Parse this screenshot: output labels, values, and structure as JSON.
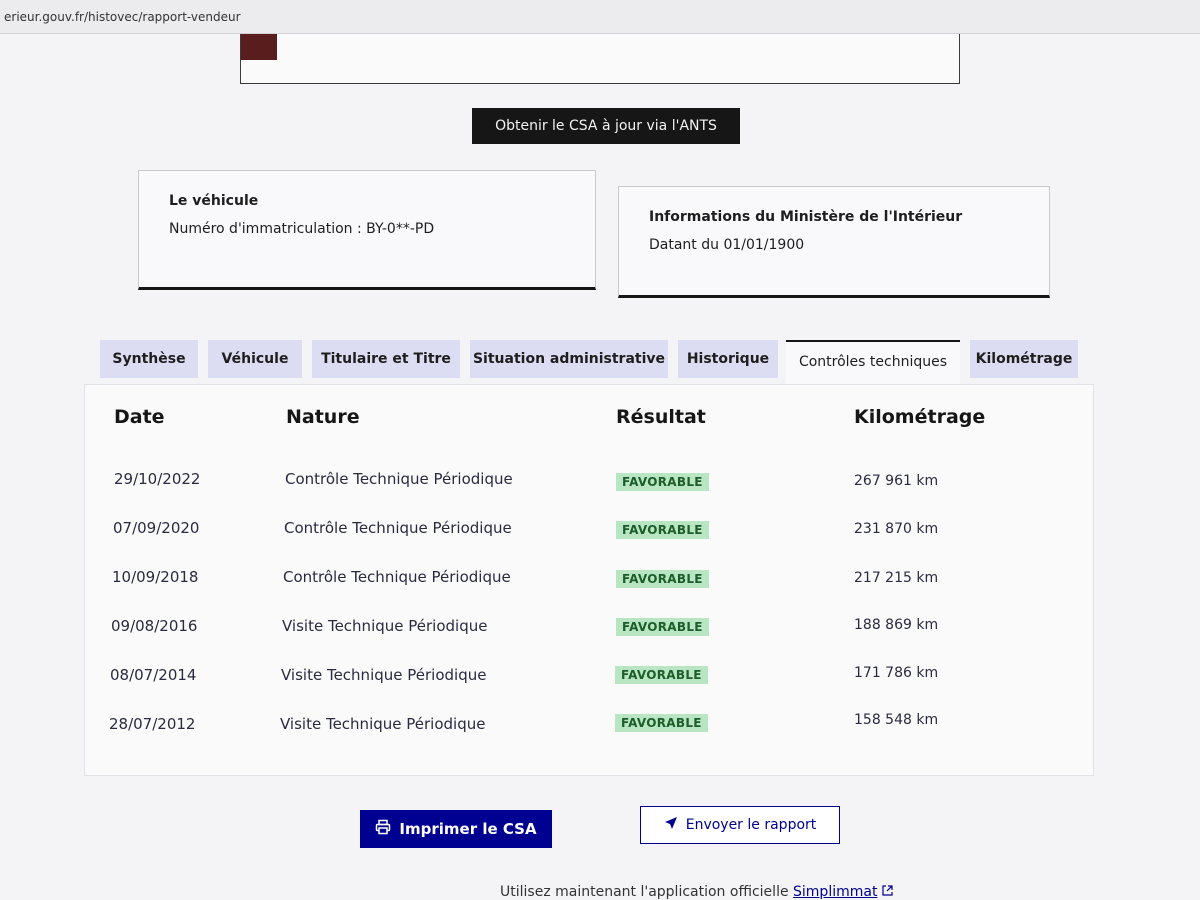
{
  "browser": {
    "url": "erieur.gouv.fr/histovec/rapport-vendeur"
  },
  "actions": {
    "ants_button": "Obtenir le CSA à jour via l'ANTS"
  },
  "vehicle_card": {
    "title": "Le véhicule",
    "immatriculation": "Numéro d'immatriculation : BY-0**-PD"
  },
  "ministere_card": {
    "title": "Informations du Ministère de l'Intérieur",
    "date": "Datant du 01/01/1900"
  },
  "tabs": [
    {
      "label": "Synthèse"
    },
    {
      "label": "Véhicule"
    },
    {
      "label": "Titulaire et Titre"
    },
    {
      "label": "Situation administrative"
    },
    {
      "label": "Historique"
    },
    {
      "label": "Contrôles techniques",
      "active": true
    },
    {
      "label": "Kilométrage"
    }
  ],
  "table": {
    "headers": {
      "date": "Date",
      "nature": "Nature",
      "resultat": "Résultat",
      "kilometrage": "Kilométrage"
    },
    "rows": [
      {
        "date": "29/10/2022",
        "nature": "Contrôle Technique Périodique",
        "resultat": "FAVORABLE",
        "kilometrage": "267 961 km"
      },
      {
        "date": "07/09/2020",
        "nature": "Contrôle Technique Périodique",
        "resultat": "FAVORABLE",
        "kilometrage": "231 870 km"
      },
      {
        "date": "10/09/2018",
        "nature": "Contrôle Technique Périodique",
        "resultat": "FAVORABLE",
        "kilometrage": "217 215 km"
      },
      {
        "date": "09/08/2016",
        "nature": "Visite Technique Périodique",
        "resultat": "FAVORABLE",
        "kilometrage": "188 869 km"
      },
      {
        "date": "08/07/2014",
        "nature": "Visite Technique Périodique",
        "resultat": "FAVORABLE",
        "kilometrage": "171 786 km"
      },
      {
        "date": "28/07/2012",
        "nature": "Visite Technique Périodique",
        "resultat": "FAVORABLE",
        "kilometrage": "158 548 km"
      }
    ]
  },
  "buttons": {
    "print_label": "Imprimer le CSA",
    "send_label": "Envoyer le rapport"
  },
  "footer": {
    "text": "Utilisez maintenant l'application officielle ",
    "link": "Simplimmat"
  },
  "colors": {
    "primary_blue": "#000091",
    "badge_green_bg": "#b8e6c2",
    "badge_green_text": "#1d5d2c",
    "tab_bg": "#dcdcf2",
    "dark_button": "#161616"
  },
  "icons": {
    "print": "printer-icon",
    "send": "send-arrow-icon",
    "external": "external-link-icon"
  }
}
